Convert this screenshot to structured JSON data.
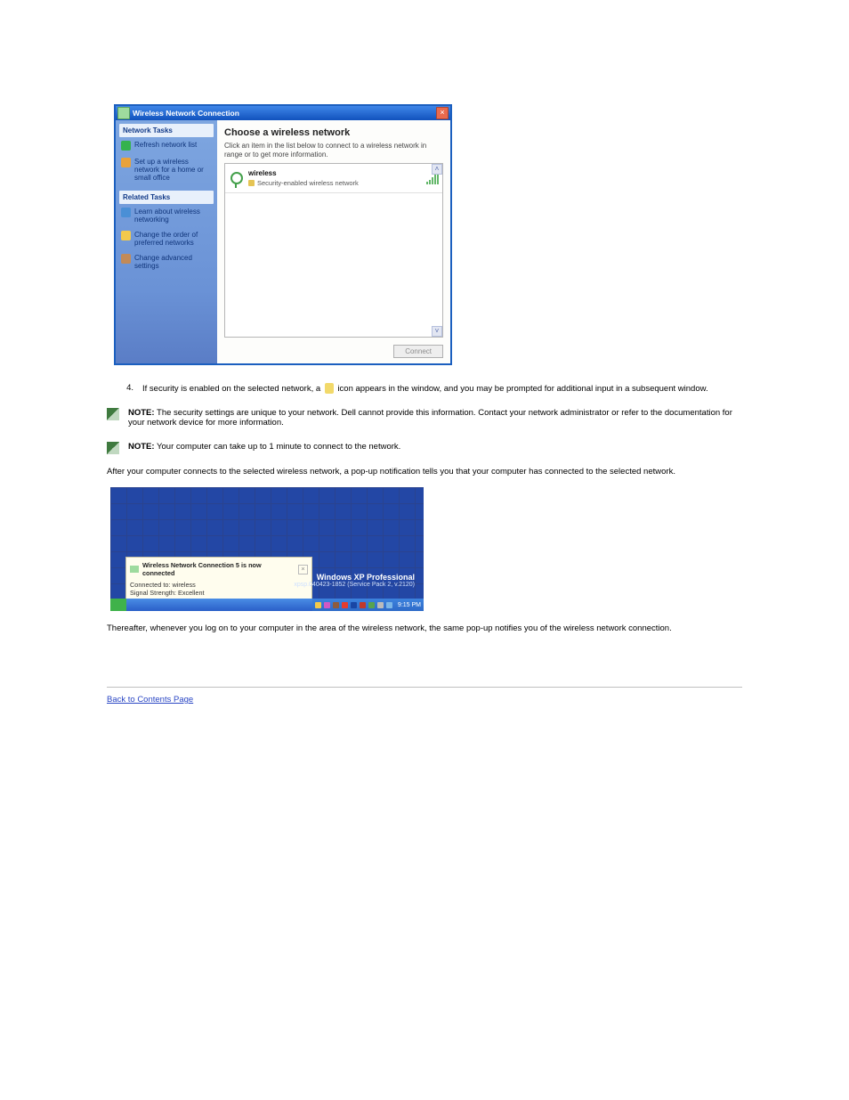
{
  "window1": {
    "title": "Wireless Network Connection",
    "sidebar": {
      "groups": [
        {
          "title": "Network Tasks",
          "items": [
            "Refresh network list",
            "Set up a wireless network for a home or small office"
          ]
        },
        {
          "title": "Related Tasks",
          "items": [
            "Learn about wireless networking",
            "Change the order of preferred networks",
            "Change advanced settings"
          ]
        }
      ]
    },
    "main_heading": "Choose a wireless network",
    "main_sub": "Click an item in the list below to connect to a wireless network in range or to get more information.",
    "networks": [
      {
        "name": "wireless",
        "desc": "Security-enabled wireless network"
      }
    ],
    "connect_btn": "Connect"
  },
  "doc": {
    "step4": {
      "num": "4.",
      "text_a": "If security is enabled on the selected network, a",
      "text_b": "icon appears in the window, and you may be prompted for additional input in a subsequent window."
    },
    "notes": [
      {
        "label": "NOTE:",
        "text": " The security settings are unique to your network. Dell cannot provide this information. Contact your network administrator or refer to the documentation for your network device for more information."
      },
      {
        "label": "NOTE:",
        "text": " Your computer can take up to 1 minute to connect to the network."
      }
    ],
    "para1": "After your computer connects to the selected wireless network, a pop-up notification tells you that your computer has connected to the selected network.",
    "para2": "Thereafter, whenever you log on to your computer in the area of the wireless network, the same pop-up notifies you of the wireless network connection.",
    "back_link": "Back to Contents Page"
  },
  "window2": {
    "tip": {
      "title": "Wireless Network Connection 5 is now connected",
      "line1": "Connected to: wireless",
      "line2": "Signal Strength: Excellent"
    },
    "brand1": "Windows XP Professional",
    "brand2": "xpsp.040423-1852 (Service Pack 2, v.2120)",
    "clock": "9:15 PM"
  }
}
